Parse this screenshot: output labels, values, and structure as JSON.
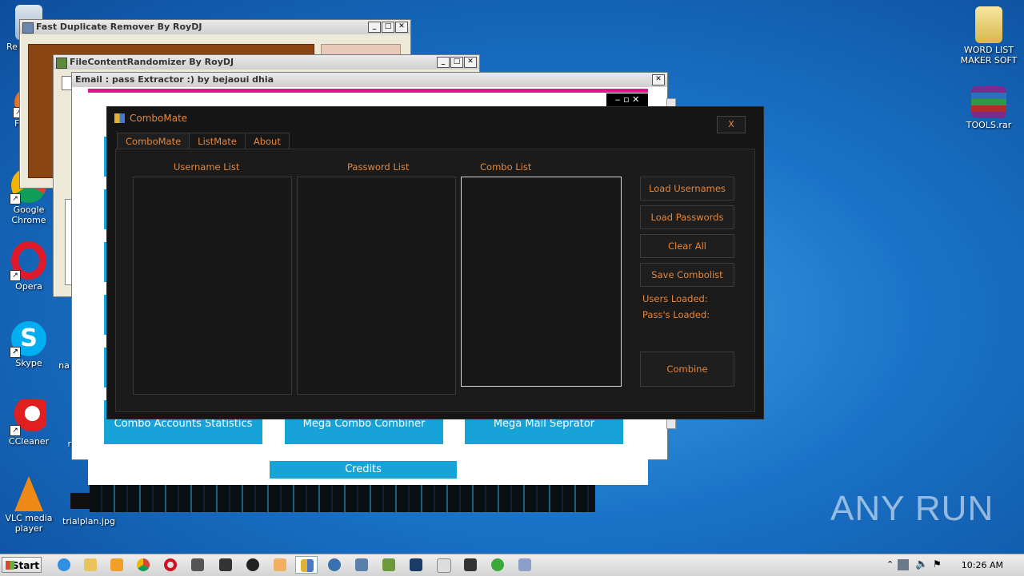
{
  "desktop": {
    "icons_left": [
      {
        "label": "Re",
        "icon": "recycle-bin-icon"
      },
      {
        "label": "F",
        "icon": "firefox-icon"
      },
      {
        "label": "Google Chrome",
        "icon": "chrome-icon"
      },
      {
        "label": "Opera",
        "icon": "opera-icon"
      },
      {
        "label": "Skype",
        "icon": "skype-icon"
      },
      {
        "label": "CCleaner",
        "icon": "ccleaner-icon"
      },
      {
        "label": "VLC media player",
        "icon": "vlc-icon"
      }
    ],
    "icons_mid": [
      {
        "label": "na"
      },
      {
        "label": "n"
      },
      {
        "label": "trialplan.jpg"
      }
    ],
    "icons_right": [
      {
        "label": "WORD LIST MAKER SOFT",
        "icon": "word-folder-icon"
      },
      {
        "label": "TOOLS.rar",
        "icon": "winrar-icon"
      }
    ],
    "watermark": "ANY RUN"
  },
  "windows": {
    "fdr": {
      "title": "Fast Duplicate Remover    By RoyDJ"
    },
    "fcr": {
      "title": "FileContentRandomizer By RoyDJ"
    },
    "epe": {
      "title": "Email : pass Extractor :) by bejaoui dhia",
      "buttons": [
        "Combo Accounts Statistics",
        "Mega Combo Combiner",
        "Mega Mail Seprator"
      ],
      "credits": "Credits"
    }
  },
  "combomate": {
    "title": "ComboMate",
    "close": "X",
    "tabs": [
      "ComboMate",
      "ListMate",
      "About"
    ],
    "labels": {
      "usernames": "Username List",
      "passwords": "Password List",
      "combo": "Combo List"
    },
    "buttons": {
      "load_usernames": "Load Usernames",
      "load_passwords": "Load Passwords",
      "clear_all": "Clear All",
      "save_combolist": "Save Combolist",
      "combine": "Combine"
    },
    "status": {
      "users": "Users Loaded:",
      "pass": "Pass's Loaded:"
    },
    "accent": "#e5863a"
  },
  "taskbar": {
    "start": "Start",
    "clock": "10:26 AM"
  }
}
